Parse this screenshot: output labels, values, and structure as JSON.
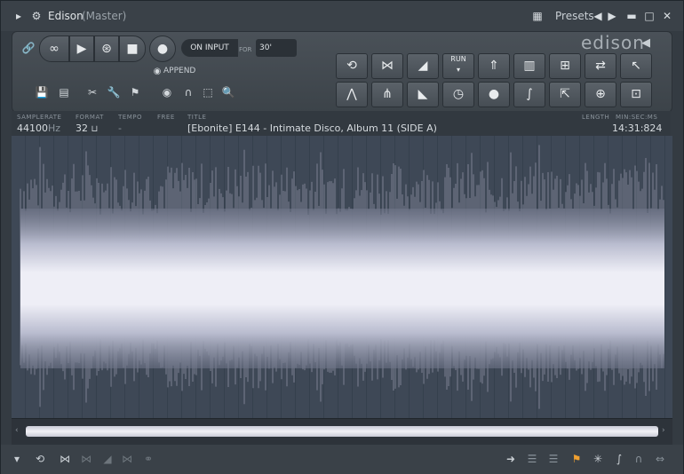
{
  "window": {
    "title": "Edison",
    "subtitle": "(Master)",
    "presets_label": "Presets"
  },
  "transport": {
    "on_input_label": "ON INPUT",
    "for_label": "FOR",
    "for_value": "30'",
    "append_label": "APPEND",
    "logo": "edison",
    "run_label": "RUN"
  },
  "info": {
    "samplerate_label": "SAMPLERATE",
    "samplerate_value": "44100",
    "samplerate_unit": "Hz",
    "format_label": "FORMAT",
    "format_value": "32",
    "tempo_label": "TEMPO",
    "tempo_value": "-",
    "free_label": "FREE",
    "title_label": "TITLE",
    "title_value": "[Ebonite] E144 - Intimate Disco, Album 11 (SIDE A)",
    "length_label": "LENGTH",
    "minsecms_label": "MIN:SEC:MS",
    "length_value": "14:31:824"
  },
  "colors": {
    "accent": "#f0a030",
    "waveform": "#e6e6f2",
    "background": "#3e4856"
  },
  "icons": {
    "top_toolbar": [
      "refresh-icon",
      "normalize-icon",
      "fade-in-icon",
      "run-icon",
      "rocket-icon",
      "spectrum-icon",
      "marker-add-icon",
      "swap-icon",
      "select-cursor-icon"
    ],
    "bottom_toolbar": [
      "tune-icon",
      "declick-icon",
      "fade-out-icon",
      "clock-icon",
      "drop-icon",
      "brush-icon",
      "marker-edit-icon",
      "save-add-icon",
      "loop-export-icon"
    ]
  }
}
